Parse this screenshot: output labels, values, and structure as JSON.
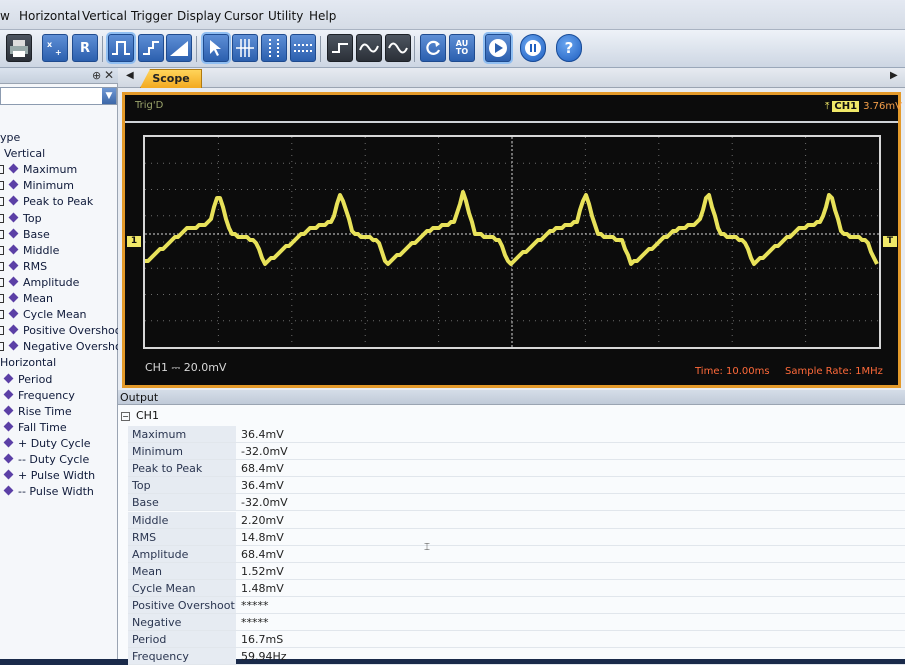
{
  "menubar": {
    "items": [
      "w",
      "Horizontal",
      "Vertical",
      "Trigger",
      "Display",
      "Cursor",
      "Utility",
      "Help"
    ]
  },
  "toolbar": {
    "reset_label": "R",
    "auto_label": "AU\nTO",
    "help_label": "?"
  },
  "left_panel": {
    "pin_icon": "pin-icon",
    "close_label": "✕",
    "tree": {
      "root": "ype",
      "vertical_group": "Vertical",
      "vertical_items": [
        "Maximum",
        "Minimum",
        "Peak to Peak",
        "Top",
        "Base",
        "Middle",
        "RMS",
        "Amplitude",
        "Mean",
        "Cycle Mean",
        "Positive Overshoot",
        "Negative Overshoot"
      ],
      "horizontal_group": "Horizontal",
      "horizontal_items": [
        "Period",
        "Frequency",
        "Rise Time",
        "Fall Time",
        "+ Duty Cycle",
        "-- Duty Cycle",
        "+ Pulse Width",
        "-- Pulse Width"
      ]
    }
  },
  "scope": {
    "tab_label": "Scope",
    "trig_label": "Trig'D",
    "ch1_badge": "CH1",
    "ch1_trigger_level": "3.76mV",
    "ch1_marker": "1",
    "trigger_marker": "T",
    "ch1_scale": "CH1 ⎓ 20.0mV",
    "time_label": "Time: 10.00ms",
    "sample_rate": "Sample Rate: 1MHz",
    "trace_color": "#e8e25a",
    "frame_color": "#e49a2a"
  },
  "output": {
    "header": "Output",
    "group": "CH1",
    "rows": [
      {
        "name": "Maximum",
        "value": "36.4mV"
      },
      {
        "name": "Minimum",
        "value": "-32.0mV"
      },
      {
        "name": "Peak to Peak",
        "value": "68.4mV"
      },
      {
        "name": "Top",
        "value": "36.4mV"
      },
      {
        "name": "Base",
        "value": "-32.0mV"
      },
      {
        "name": "Middle",
        "value": "2.20mV"
      },
      {
        "name": "RMS",
        "value": "14.8mV"
      },
      {
        "name": "Amplitude",
        "value": "68.4mV"
      },
      {
        "name": "Mean",
        "value": "1.52mV"
      },
      {
        "name": "Cycle Mean",
        "value": "1.48mV"
      },
      {
        "name": "Positive Overshoot",
        "value": "*****"
      },
      {
        "name": "Negative Overshoot",
        "value": "*****"
      },
      {
        "name": "Period",
        "value": "16.7mS"
      },
      {
        "name": "Frequency",
        "value": "59.94Hz"
      }
    ]
  }
}
